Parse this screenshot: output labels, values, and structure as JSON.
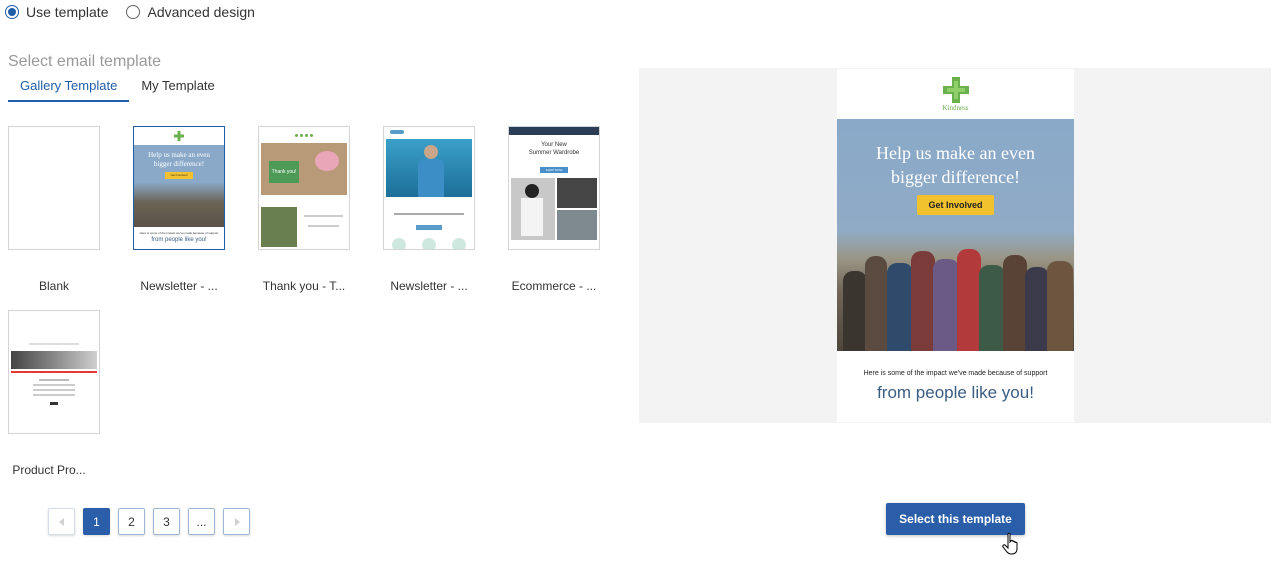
{
  "design_mode": {
    "options": [
      {
        "label": "Use template",
        "selected": true
      },
      {
        "label": "Advanced design",
        "selected": false
      }
    ]
  },
  "section_title": "Select email template",
  "tabs": [
    {
      "label": "Gallery Template",
      "active": true
    },
    {
      "label": "My Template",
      "active": false
    }
  ],
  "templates": [
    {
      "label": "Blank"
    },
    {
      "label": "Newsletter - ...",
      "selected": true
    },
    {
      "label": "Thank you - T..."
    },
    {
      "label": "Newsletter - ..."
    },
    {
      "label": "Ecommerce - ..."
    },
    {
      "label": "Product Pro..."
    }
  ],
  "pagination": {
    "pages": [
      "1",
      "2",
      "3",
      "..."
    ],
    "current": "1"
  },
  "preview": {
    "logo_text": "Kindness",
    "headline_line1": "Help us make an even",
    "headline_line2": "bigger difference!",
    "cta_label": "Get Involved",
    "impact_text": "Here is some of the impact we've made because of support",
    "tagline": "from people like you!"
  },
  "thumb_text": {
    "newsletter_headline_line1": "Help us make an even",
    "newsletter_headline_line2": "bigger difference!",
    "newsletter_cta": "Get Involved",
    "newsletter_impact": "Here is some of the impact we've made because of support",
    "newsletter_tagline": "from people like you!",
    "ecommerce_headline_line1": "Your New",
    "ecommerce_headline_line2": "Summer Wardrobe",
    "ecommerce_cta": "SHOP NOW",
    "thankyou_card_text": "Thank you!"
  },
  "select_button_label": "Select this template",
  "colors": {
    "accent": "#1f5ea8",
    "button": "#2a5ea8",
    "preview_sky": "#8aa9c9",
    "cta_yellow": "#f2c12e",
    "logo_green": "#6ab04c"
  }
}
